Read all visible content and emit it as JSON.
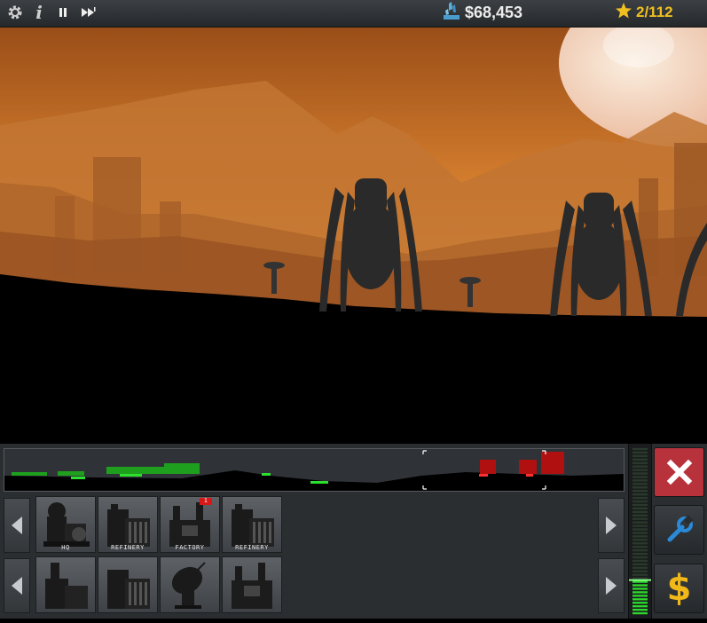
{
  "topbar": {
    "settings_icon": "gear-icon",
    "info_icon": "info-icon",
    "pause_icon": "pause-icon",
    "fast_forward_icon": "fast-forward-icon",
    "money": "$68,453",
    "money_icon": "crystal-icon",
    "stars": "2/112",
    "stars_icon": "star-icon",
    "colors": {
      "stars": "#f0c020",
      "money": "#ececec"
    }
  },
  "build_rows": [
    {
      "items": [
        {
          "label": "HQ",
          "icon": "hq-building-icon"
        },
        {
          "label": "REFINERY",
          "icon": "refinery-building-icon"
        },
        {
          "label": "FACTORY",
          "icon": "factory-building-icon",
          "badge": "1"
        },
        {
          "label": "REFINERY",
          "icon": "refinery-building-icon"
        }
      ]
    },
    {
      "items": [
        {
          "label": "",
          "icon": "silo-building-icon"
        },
        {
          "label": "",
          "icon": "refinery-building-icon"
        },
        {
          "label": "",
          "icon": "radar-dish-building-icon"
        },
        {
          "label": "",
          "icon": "factory-building-icon"
        }
      ]
    }
  ],
  "actions": {
    "cancel_icon": "close-icon",
    "repair_icon": "wrench-icon",
    "sell_icon": "dollar-icon",
    "colors": {
      "cancel": "#b8323c",
      "repair": "#2a8ad8",
      "sell": "#f0b818"
    }
  },
  "power_meter": {
    "level": 0.2
  }
}
